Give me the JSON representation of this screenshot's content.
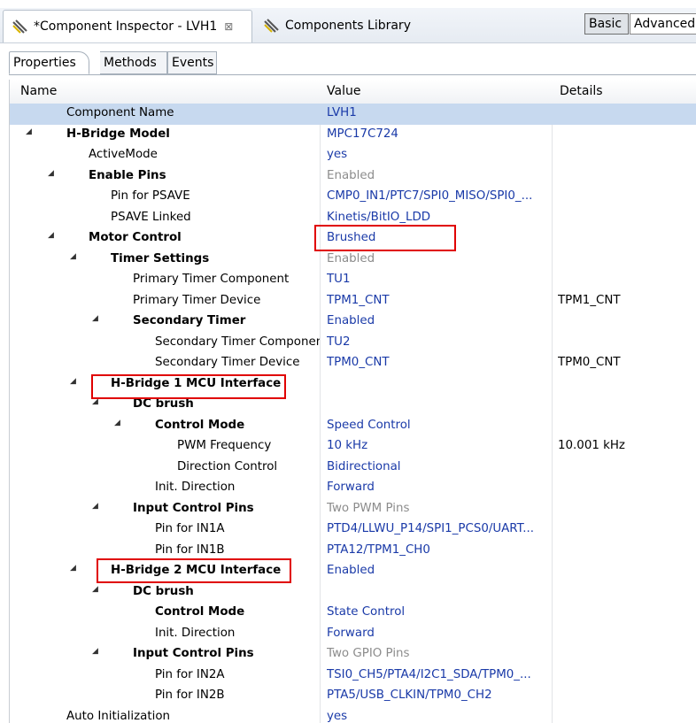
{
  "tabs": {
    "inspector": "*Component Inspector - LVH1",
    "close": "⊠",
    "library": "Components Library"
  },
  "mode": {
    "basic": "Basic",
    "advanced": "Advanced"
  },
  "subtabs": [
    "Properties",
    "Methods",
    "Events"
  ],
  "columns": {
    "name": "Name",
    "value": "Value",
    "details": "Details"
  },
  "rows": [
    {
      "name": "Component Name",
      "value": "LVH1",
      "details": "",
      "bold": false,
      "level": 0,
      "expand": false,
      "grey": false
    },
    {
      "name": "H-Bridge Model",
      "value": "MPC17C724",
      "details": "",
      "bold": true,
      "level": 0,
      "expand": true,
      "grey": false
    },
    {
      "name": "ActiveMode",
      "value": "yes",
      "details": "",
      "bold": false,
      "level": 1,
      "expand": false,
      "grey": false
    },
    {
      "name": "Enable Pins",
      "value": "Enabled",
      "details": "",
      "bold": true,
      "level": 1,
      "expand": true,
      "grey": true
    },
    {
      "name": "Pin for PSAVE",
      "value": "CMP0_IN1/PTC7/SPI0_MISO/SPI0_...",
      "details": "",
      "bold": false,
      "level": 2,
      "expand": false,
      "grey": false
    },
    {
      "name": "PSAVE Linked",
      "value": "Kinetis/BitIO_LDD",
      "details": "",
      "bold": false,
      "level": 2,
      "expand": false,
      "grey": false
    },
    {
      "name": "Motor Control",
      "value": "Brushed",
      "details": "",
      "bold": true,
      "level": 1,
      "expand": true,
      "grey": false
    },
    {
      "name": "Timer Settings",
      "value": "Enabled",
      "details": "",
      "bold": true,
      "level": 2,
      "expand": true,
      "grey": true
    },
    {
      "name": "Primary Timer Component",
      "value": "TU1",
      "details": "",
      "bold": false,
      "level": 3,
      "expand": false,
      "grey": false
    },
    {
      "name": "Primary Timer Device",
      "value": "TPM1_CNT",
      "details": "TPM1_CNT",
      "bold": false,
      "level": 3,
      "expand": false,
      "grey": false
    },
    {
      "name": "Secondary Timer",
      "value": "Enabled",
      "details": "",
      "bold": true,
      "level": 3,
      "expand": true,
      "grey": false
    },
    {
      "name": "Secondary Timer Component",
      "value": "TU2",
      "details": "",
      "bold": false,
      "level": 4,
      "expand": false,
      "grey": false
    },
    {
      "name": "Secondary Timer Device",
      "value": "TPM0_CNT",
      "details": "TPM0_CNT",
      "bold": false,
      "level": 4,
      "expand": false,
      "grey": false
    },
    {
      "name": "H-Bridge 1 MCU Interface",
      "value": "",
      "details": "",
      "bold": true,
      "level": 2,
      "expand": true,
      "grey": false
    },
    {
      "name": "DC brush",
      "value": "",
      "details": "",
      "bold": true,
      "level": 3,
      "expand": true,
      "grey": false
    },
    {
      "name": "Control Mode",
      "value": "Speed Control",
      "details": "",
      "bold": true,
      "level": 4,
      "expand": true,
      "grey": false
    },
    {
      "name": "PWM Frequency",
      "value": "10 kHz",
      "details": "10.001 kHz",
      "bold": false,
      "level": 5,
      "expand": false,
      "grey": false
    },
    {
      "name": "Direction Control",
      "value": "Bidirectional",
      "details": "",
      "bold": false,
      "level": 5,
      "expand": false,
      "grey": false
    },
    {
      "name": "Init. Direction",
      "value": "Forward",
      "details": "",
      "bold": false,
      "level": 4,
      "expand": false,
      "grey": false
    },
    {
      "name": "Input Control Pins",
      "value": "Two PWM Pins",
      "details": "",
      "bold": true,
      "level": 3,
      "expand": true,
      "grey": true
    },
    {
      "name": "Pin for IN1A",
      "value": "PTD4/LLWU_P14/SPI1_PCS0/UART...",
      "details": "",
      "bold": false,
      "level": 4,
      "expand": false,
      "grey": false
    },
    {
      "name": "Pin for IN1B",
      "value": "PTA12/TPM1_CH0",
      "details": "",
      "bold": false,
      "level": 4,
      "expand": false,
      "grey": false
    },
    {
      "name": "H-Bridge 2 MCU Interface",
      "value": "Enabled",
      "details": "",
      "bold": true,
      "level": 2,
      "expand": true,
      "grey": false
    },
    {
      "name": "DC brush",
      "value": "",
      "details": "",
      "bold": true,
      "level": 3,
      "expand": true,
      "grey": false
    },
    {
      "name": "Control Mode",
      "value": "State Control",
      "details": "",
      "bold": true,
      "level": 4,
      "expand": false,
      "grey": false
    },
    {
      "name": "Init. Direction",
      "value": "Forward",
      "details": "",
      "bold": false,
      "level": 4,
      "expand": false,
      "grey": false
    },
    {
      "name": "Input Control Pins",
      "value": "Two GPIO Pins",
      "details": "",
      "bold": true,
      "level": 3,
      "expand": true,
      "grey": true
    },
    {
      "name": "Pin for IN2A",
      "value": "TSI0_CH5/PTA4/I2C1_SDA/TPM0_...",
      "details": "",
      "bold": false,
      "level": 4,
      "expand": false,
      "grey": false
    },
    {
      "name": "Pin for IN2B",
      "value": "PTA5/USB_CLKIN/TPM0_CH2",
      "details": "",
      "bold": false,
      "level": 4,
      "expand": false,
      "grey": false
    },
    {
      "name": "Auto Initialization",
      "value": "yes",
      "details": "",
      "bold": false,
      "level": 0,
      "expand": false,
      "grey": false
    }
  ],
  "colors": {
    "value_text": "#1a3aa8",
    "disabled_text": "#8c8c8c",
    "selected_row": "#c7d9ef",
    "highlight_box": "#e00000"
  }
}
